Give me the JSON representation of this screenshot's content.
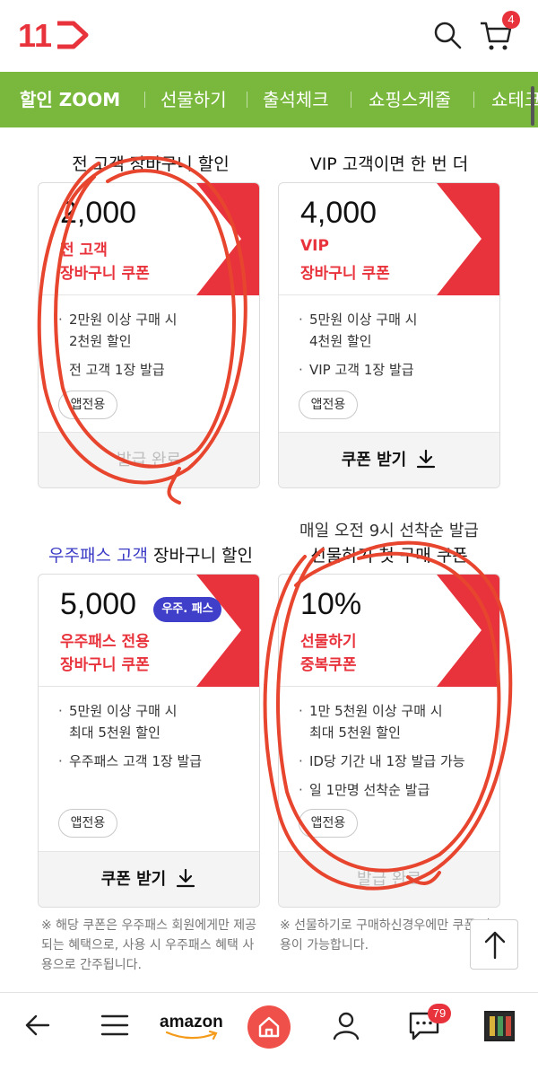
{
  "header": {
    "logo_text": "11",
    "cart_count": "4"
  },
  "nav": {
    "items": [
      "할인 ZOOM",
      "선물하기",
      "출석체크",
      "쇼핑스케줄",
      "쇼테크"
    ]
  },
  "coupons": [
    {
      "title": "전 고객 장바구니 할인",
      "amount": "2,000",
      "sub1": "전 고객",
      "sub2": "장바구니 쿠폰",
      "bullets": [
        "2만원 이상 구매 시\n2천원 할인",
        "전 고객 1장 발급"
      ],
      "app_tag": "앱전용",
      "button": "발급 완료"
    },
    {
      "title": "VIP 고객이면 한 번 더",
      "amount": "4,000",
      "sub1": "VIP",
      "sub2": "장바구니 쿠폰",
      "bullets": [
        "5만원 이상 구매 시\n4천원 할인",
        "VIP 고객 1장 발급"
      ],
      "app_tag": "앱전용",
      "button": "쿠폰 받기"
    },
    {
      "title_highlight": "우주패스 고객",
      "title_rest": " 장바구니 할인",
      "amount": "5,000",
      "badge": "우주. 패스",
      "sub1": "우주패스 전용",
      "sub2": "장바구니 쿠폰",
      "bullets": [
        "5만원 이상 구매 시\n최대 5천원 할인",
        "우주패스 고객 1장 발급"
      ],
      "app_tag": "앱전용",
      "button": "쿠폰 받기",
      "note": "※ 해당 쿠폰은 우주패스 회원에게만 제공되는 혜택으로, 사용 시 우주패스 혜택 사용으로 간주됩니다."
    },
    {
      "top_note": "매일 오전 9시 선착순 발급",
      "title": "선물하기 첫 구매 쿠폰",
      "amount": "10%",
      "sub1": "선물하기",
      "sub2": "중복쿠폰",
      "bullets": [
        "1만 5천원 이상 구매 시\n최대 5천원 할인",
        "ID당 기간 내 1장 발급 가능",
        "일 1만명 선착순 발급"
      ],
      "app_tag": "앱전용",
      "button": "발급 완료",
      "note": "※ 선물하기로 구매하신경우에만 쿠폰 사용이 가능합니다."
    }
  ],
  "bottom_bar": {
    "amazon_label": "amazon",
    "chat_count": "79"
  },
  "colors": {
    "brand_red": "#e8333c",
    "nav_green": "#79b83c",
    "pass_blue": "#3f3fc9",
    "annotation_red": "#e8452f"
  }
}
